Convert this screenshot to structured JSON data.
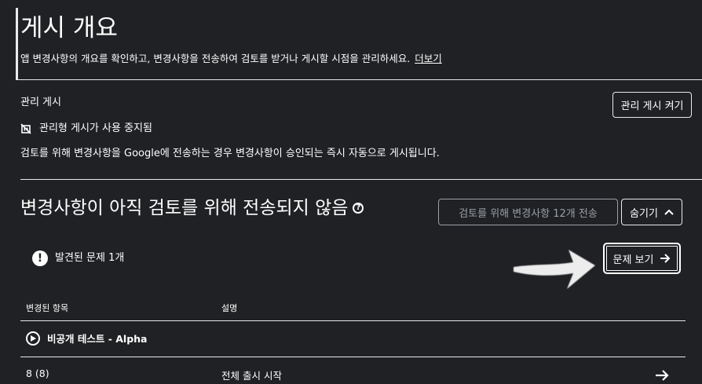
{
  "header": {
    "title": "게시 개요",
    "description": "앱 변경사항의 개요를 확인하고, 변경사항을 전송하여 검토를 받거나 게시할 시점을 관리하세요.",
    "learn_more": "더보기"
  },
  "managed_publishing": {
    "label": "관리 게시",
    "turn_on_button": "관리 게시 켜기",
    "status": "관리형 게시가 사용 중지됨",
    "info": "검토를 위해 변경사항을 Google에 전송하는 경우 변경사항이 승인되는 즉시 자동으로 게시됩니다."
  },
  "changes_section": {
    "title": "변경사항이 아직 검토를 위해 전송되지 않음",
    "send_button": "검토를 위해 변경사항 12개 전송",
    "hide_button": "숨기기",
    "issues_text": "발견된 문제 1개",
    "view_issues_button": "문제 보기"
  },
  "table": {
    "headers": [
      "변경된 항목",
      "설명"
    ],
    "rows": [
      {
        "group": "비공개 테스트 - Alpha"
      },
      {
        "item": "8 (8)",
        "description": "전체 출시 시작"
      }
    ]
  },
  "icons": {
    "help": "help-circle-icon",
    "issue": "exclamation-circle-icon",
    "paused": "publishing-paused-icon",
    "track": "play-circle-icon",
    "arrow": "arrow-right-icon"
  }
}
